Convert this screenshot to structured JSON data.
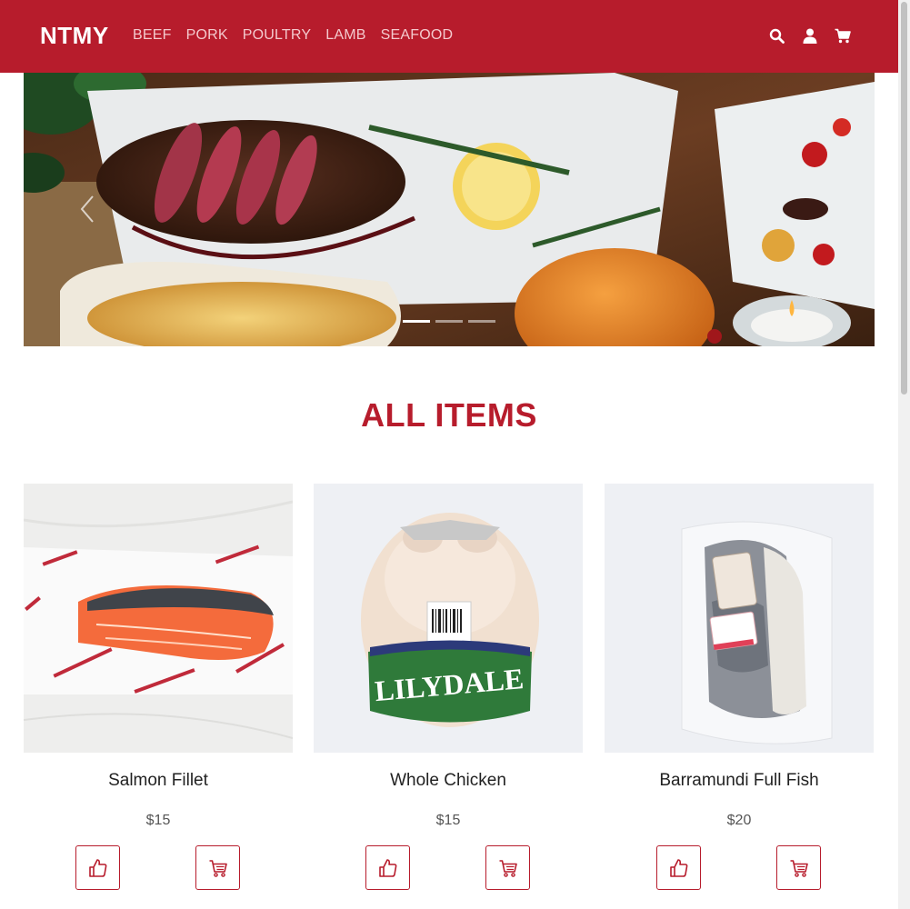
{
  "navbar": {
    "brand": "NTMY",
    "links": [
      "BEEF",
      "PORK",
      "POULTRY",
      "LAMB",
      "SEAFOOD"
    ],
    "icons": [
      "search-icon",
      "user-icon",
      "cart-icon"
    ]
  },
  "carousel": {
    "prev_icon": "chevron-left-icon",
    "slide_count": 3,
    "active_slide": 1
  },
  "section": {
    "title": "ALL ITEMS"
  },
  "products": [
    {
      "name": "Salmon Fillet",
      "price": "$15",
      "like_icon": "thumbs-up-icon",
      "cart_icon": "cart-icon"
    },
    {
      "name": "Whole Chicken",
      "price": "$15",
      "like_icon": "thumbs-up-icon",
      "cart_icon": "cart-icon"
    },
    {
      "name": "Barramundi Full Fish",
      "price": "$20",
      "like_icon": "thumbs-up-icon",
      "cart_icon": "cart-icon"
    }
  ],
  "colors": {
    "brand": "#b71c2c",
    "nav_link": "#f4c9cd"
  }
}
